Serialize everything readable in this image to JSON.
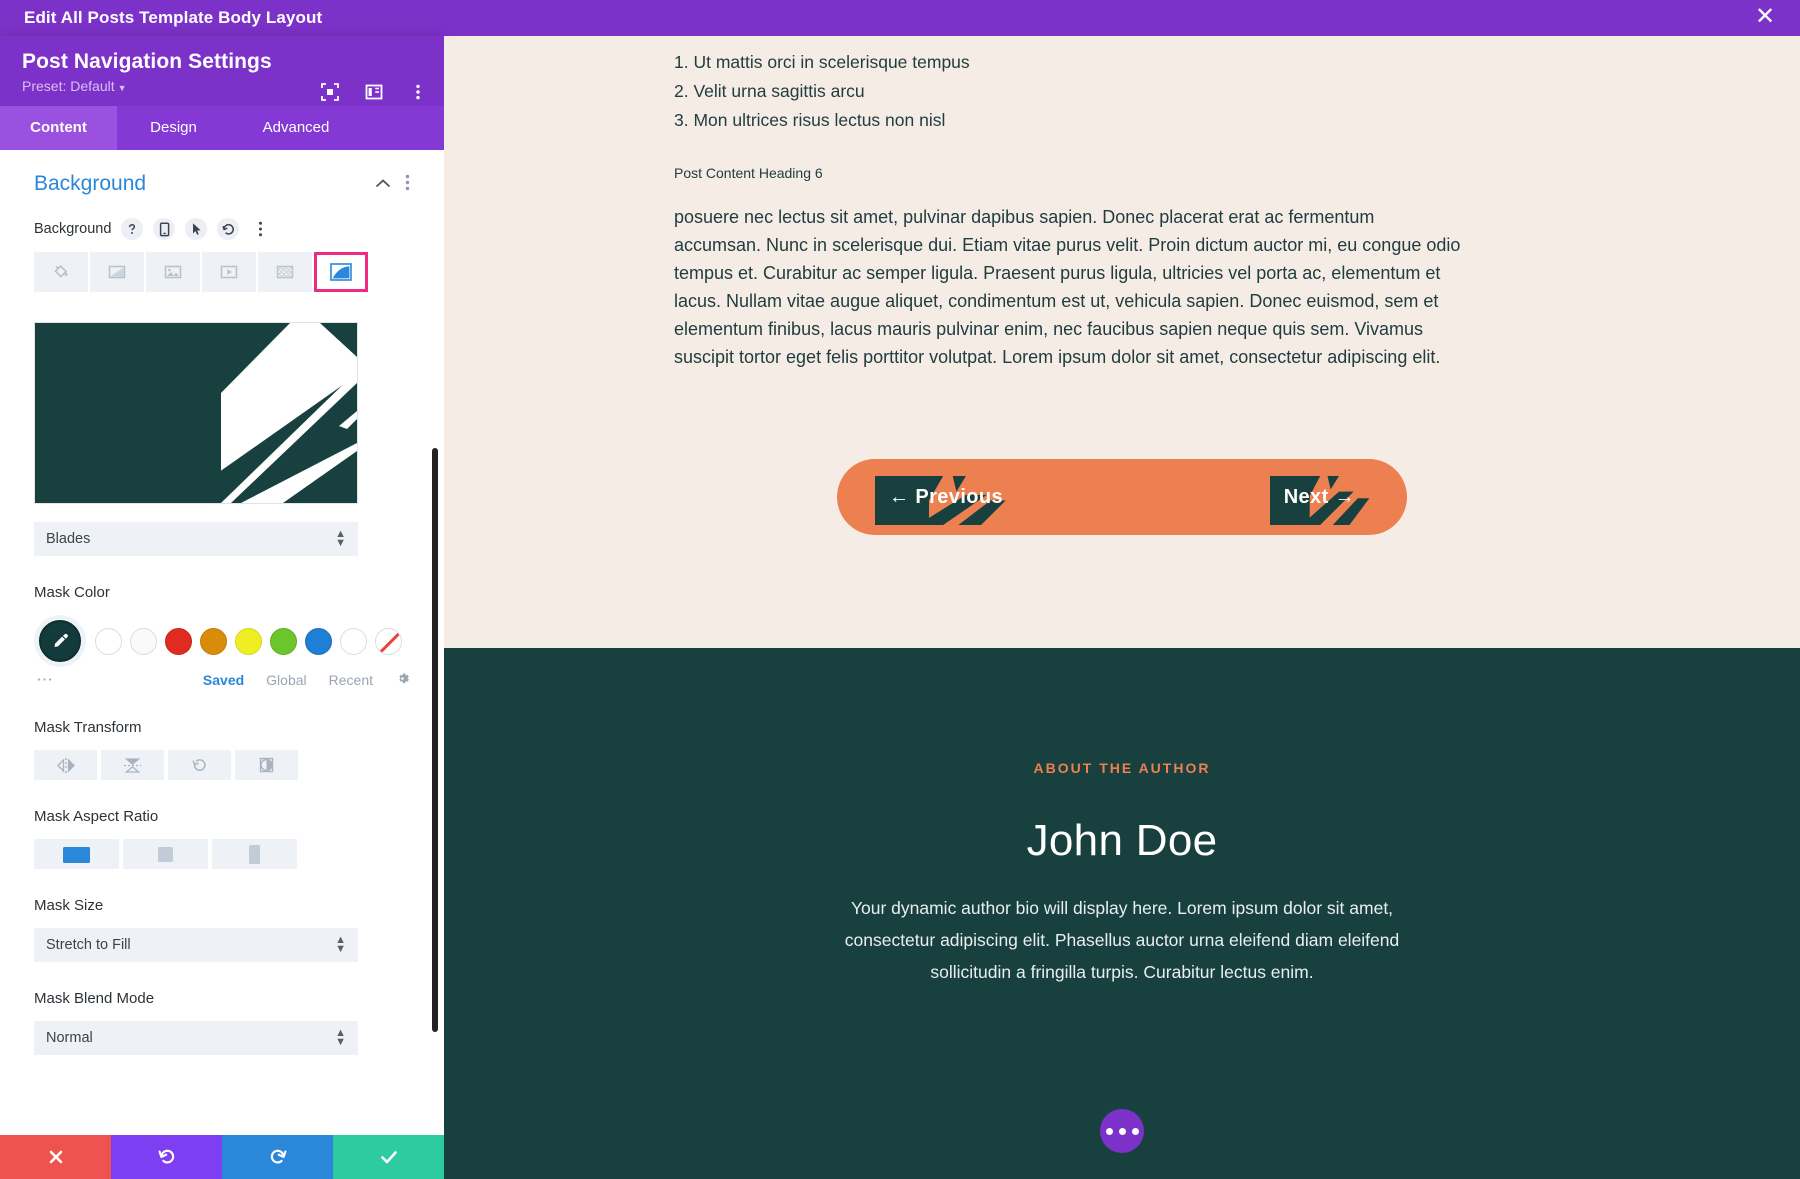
{
  "topbar": {
    "title": "Edit All Posts Template Body Layout",
    "close_icon": "close-icon"
  },
  "panel": {
    "title": "Post Navigation Settings",
    "preset_label": "Preset: Default",
    "header_icons": [
      "focus-icon",
      "layout-columns-icon",
      "vertical-dots-icon"
    ],
    "tabs": [
      {
        "label": "Content",
        "active": true
      },
      {
        "label": "Design",
        "active": false
      },
      {
        "label": "Advanced",
        "active": false
      }
    ],
    "section": {
      "title": "Background",
      "collapse_icon": "chevron-up-icon",
      "menu_icon": "vertical-dots-icon"
    },
    "background_field": {
      "label": "Background",
      "tool_icons": [
        "help-icon",
        "responsive-icon",
        "hover-icon",
        "reset-icon",
        "vertical-dots-icon"
      ],
      "types": [
        {
          "name": "color-fill-icon",
          "active": false
        },
        {
          "name": "gradient-icon",
          "active": false
        },
        {
          "name": "image-icon",
          "active": false
        },
        {
          "name": "video-icon",
          "active": false
        },
        {
          "name": "pattern-icon",
          "active": false
        },
        {
          "name": "mask-icon",
          "active": true
        }
      ]
    },
    "mask_style": {
      "label": "",
      "value": "Blades",
      "preview_color": "#17403f"
    },
    "mask_color": {
      "label": "Mask Color",
      "picker_icon": "eyedropper-icon",
      "picker_color": "#143b3c",
      "swatches": [
        "#ffffff",
        "#fafafa",
        "#e02b20",
        "#d98c09",
        "#eeee22",
        "#6cc62b",
        "#1f7fd4",
        "#ffffff"
      ],
      "none_swatch": "transparent-none-swatch",
      "more_icon": "more-dots-icon",
      "tabs": [
        {
          "label": "Saved",
          "active": true
        },
        {
          "label": "Global",
          "active": false
        },
        {
          "label": "Recent",
          "active": false
        }
      ],
      "settings_icon": "gear-icon"
    },
    "mask_transform": {
      "label": "Mask Transform",
      "buttons": [
        "flip-horizontal-icon",
        "flip-vertical-icon",
        "rotate-icon",
        "invert-icon"
      ]
    },
    "mask_aspect_ratio": {
      "label": "Mask Aspect Ratio",
      "options": [
        {
          "name": "landscape-ratio-icon",
          "active": true
        },
        {
          "name": "square-ratio-icon",
          "active": false
        },
        {
          "name": "portrait-ratio-icon",
          "active": false
        }
      ]
    },
    "mask_size": {
      "label": "Mask Size",
      "value": "Stretch to Fill"
    },
    "mask_blend_mode": {
      "label": "Mask Blend Mode",
      "value": "Normal"
    },
    "footer": {
      "cancel_icon": "close-icon",
      "undo_icon": "undo-icon",
      "redo_icon": "redo-icon",
      "save_icon": "checkmark-icon"
    }
  },
  "preview": {
    "list_items": [
      "1. Ut mattis orci in scelerisque tempus",
      "2. Velit urna sagittis arcu",
      "3. Mon ultrices risus lectus non nisl"
    ],
    "heading6": "Post Content Heading 6",
    "paragraph": "posuere nec lectus sit amet, pulvinar dapibus sapien. Donec placerat erat ac fermentum accumsan. Nunc in scelerisque dui. Etiam vitae purus velit. Proin dictum auctor mi, eu congue odio tempus et. Curabitur ac semper ligula. Praesent purus ligula, ultricies vel porta ac, elementum et lacus. Nullam vitae augue aliquet, condimentum est ut, vehicula sapien. Donec euismod, sem et elementum finibus, lacus mauris pulvinar enim, nec faucibus sapien neque quis sem. Vivamus suscipit tortor eget felis porttitor volutpat. Lorem ipsum dolor sit amet, consectetur adipiscing elit.",
    "nav": {
      "previous_label": "← Previous",
      "next_label": "Next →",
      "bar_color": "#ed8050",
      "mask_color": "#17403f"
    },
    "author": {
      "eyebrow": "ABOUT THE AUTHOR",
      "eyebrow_color": "#ed8050",
      "name": "John Doe",
      "bio": "Your dynamic author bio will display here. Lorem ipsum dolor sit amet, consectetur adipiscing elit. Phasellus auctor urna eleifend diam eleifend sollicitudin a fringilla turpis. Curabitur lectus enim.",
      "section_bg": "#17403f"
    },
    "fab_icon": "ellipsis-icon",
    "top_bg": "#f6ece6"
  }
}
